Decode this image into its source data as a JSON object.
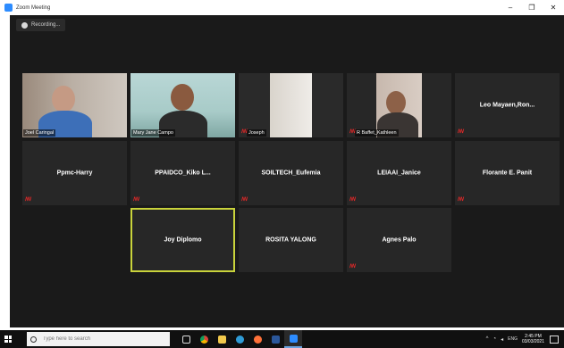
{
  "window": {
    "title": "Zoom Meeting",
    "controls": [
      "–",
      "❐",
      "✕"
    ]
  },
  "recording": {
    "label": "Recording..."
  },
  "participants": [
    {
      "name": "Joel Caringal",
      "video": true,
      "muted": false
    },
    {
      "name": "Mary Jane Campo",
      "video": true,
      "muted": false
    },
    {
      "name": "Joseph",
      "video": true,
      "muted": true
    },
    {
      "name": "R Baffet_Kathleen",
      "video": true,
      "muted": true
    },
    {
      "name": "Leo Mayaen,Ron...",
      "video": false,
      "muted": true
    },
    {
      "name": "Ppmc-Harry",
      "video": false,
      "muted": true
    },
    {
      "name": "PPAIDCO_Kiko L...",
      "video": false,
      "muted": true
    },
    {
      "name": "SOILTECH_Eufemia",
      "video": false,
      "muted": true
    },
    {
      "name": "LEIAAI_Janice",
      "video": false,
      "muted": true
    },
    {
      "name": "Florante E. Panit",
      "video": false,
      "muted": true
    },
    {
      "name": "Joy Diplomo",
      "video": false,
      "muted": false,
      "active_speaker": true
    },
    {
      "name": "ROSITA YALONG",
      "video": false,
      "muted": false
    },
    {
      "name": "Agnes Palo",
      "video": false,
      "muted": true
    }
  ],
  "taskbar": {
    "search_placeholder": "Type here to search",
    "tray": {
      "language": "ENG",
      "time": "2:45 PM",
      "date": "03/03/2021"
    },
    "icons": [
      "task-view-icon",
      "chrome-icon",
      "file-explorer-icon",
      "edge-icon",
      "firefox-icon",
      "word-icon",
      "zoom-icon"
    ]
  },
  "colors": {
    "accent_speaker": "#c9d33b",
    "mute_red": "#e02828",
    "zoom_blue": "#2D8CFF"
  }
}
